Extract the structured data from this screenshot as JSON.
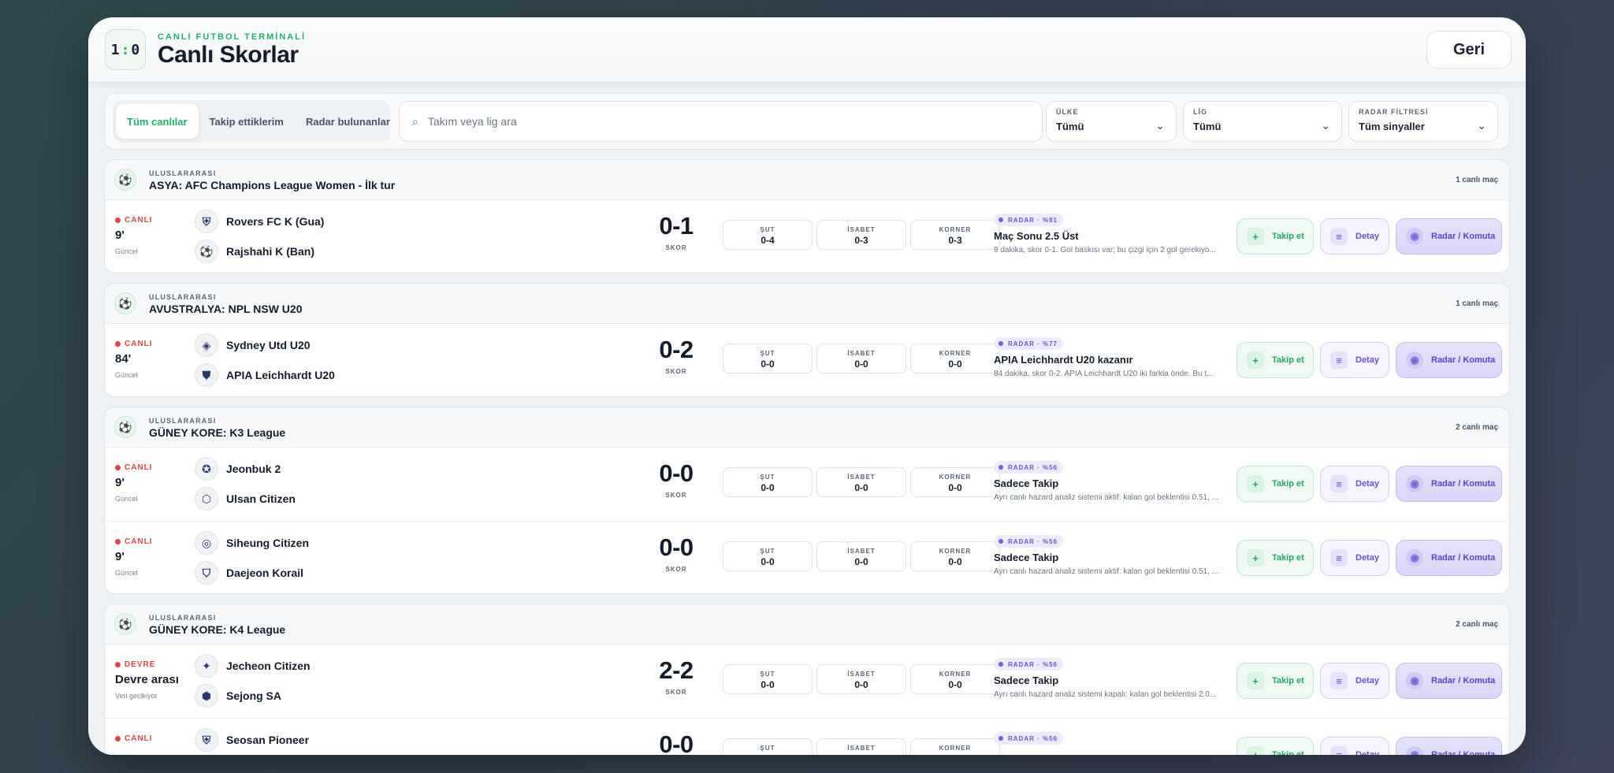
{
  "header": {
    "logo_left": "1",
    "logo_sep": ":",
    "logo_right": "0",
    "eyebrow": "CANLI FUTBOL TERMİNALİ",
    "title": "Canlı Skorlar",
    "back_label": "Geri"
  },
  "filters": {
    "tabs": [
      {
        "label": "Tüm canlılar",
        "active": true
      },
      {
        "label": "Takip ettiklerim",
        "active": false
      },
      {
        "label": "Radar bulunanlar",
        "active": false
      }
    ],
    "search_placeholder": "Takım veya lig ara",
    "country": {
      "label": "ÜLKE",
      "value": "Tümü"
    },
    "league": {
      "label": "LİG",
      "value": "Tümü"
    },
    "radar": {
      "label": "RADAR FİLTRESİ",
      "value": "Tüm sinyaller"
    }
  },
  "labels": {
    "score": "SKOR",
    "shots": "ŞUT",
    "on_target": "İSABET",
    "corners": "KORNER",
    "follow": "Takip et",
    "detail": "Detay",
    "radar_command": "Radar / Komuta"
  },
  "leagues": [
    {
      "region": "ULUSLARARASI",
      "name": "ASYA: AFC Champions League Women - İlk tur",
      "count": "1 canlı maç",
      "matches": [
        {
          "status": "CANLI",
          "minute": "9'",
          "sub": "Güncel",
          "home": "Rovers FC K (Gua)",
          "away": "Rajshahi K (Ban)",
          "score": "0-1",
          "shots": "0-4",
          "on_target": "0-3",
          "corners": "0-3",
          "radar": "RADAR · %91",
          "pick": "Maç Sonu 2.5 Üst",
          "desc": "9 dakika, skor 0-1. Gol baskısı var; bu çizgi için 2 gol gerekiyo..."
        }
      ]
    },
    {
      "region": "ULUSLARARASI",
      "name": "AVUSTRALYA: NPL NSW U20",
      "count": "1 canlı maç",
      "matches": [
        {
          "status": "CANLI",
          "minute": "84'",
          "sub": "Güncel",
          "home": "Sydney Utd U20",
          "away": "APIA Leichhardt U20",
          "score": "0-2",
          "shots": "0-0",
          "on_target": "0-0",
          "corners": "0-0",
          "radar": "RADAR · %77",
          "pick": "APIA Leichhardt U20 kazanır",
          "desc": "84 dakika, skor 0-2. APIA Leichhardt U20 iki farkla önde. Bu t..."
        }
      ]
    },
    {
      "region": "ULUSLARARASI",
      "name": "GÜNEY KORE: K3 League",
      "count": "2 canlı maç",
      "matches": [
        {
          "status": "CANLI",
          "minute": "9'",
          "sub": "Güncel",
          "home": "Jeonbuk 2",
          "away": "Ulsan Citizen",
          "score": "0-0",
          "shots": "0-0",
          "on_target": "0-0",
          "corners": "0-0",
          "radar": "RADAR · %56",
          "pick": "Sadece Takip",
          "desc": "Ayrı canlı hazard analiz sistemi aktif: kalan gol beklentisi 0.51, ..."
        },
        {
          "status": "CANLI",
          "minute": "9'",
          "sub": "Güncel",
          "home": "Siheung Citizen",
          "away": "Daejeon Korail",
          "score": "0-0",
          "shots": "0-0",
          "on_target": "0-0",
          "corners": "0-0",
          "radar": "RADAR · %56",
          "pick": "Sadece Takip",
          "desc": "Ayrı canlı hazard analiz sistemi aktif: kalan gol beklentisi 0.51, ..."
        }
      ]
    },
    {
      "region": "ULUSLARARASI",
      "name": "GÜNEY KORE: K4 League",
      "count": "2 canlı maç",
      "matches": [
        {
          "status": "DEVRE",
          "minute": "Devre arası",
          "sub": "Veri gecikiyor",
          "home": "Jecheon Citizen",
          "away": "Sejong SA",
          "score": "2-2",
          "shots": "0-0",
          "on_target": "0-0",
          "corners": "0-0",
          "radar": "RADAR · %56",
          "pick": "Sadece Takip",
          "desc": "Ayrı canlı hazard analiz sistemi kapalı: kalan gol beklentisi 2.0..."
        },
        {
          "status": "CANLI",
          "minute": "",
          "sub": "",
          "home": "Seosan Pioneer",
          "away": "",
          "score": "0-0",
          "shots": "",
          "on_target": "",
          "corners": "",
          "radar": "RADAR · %56",
          "pick": "",
          "desc": ""
        }
      ]
    }
  ]
}
